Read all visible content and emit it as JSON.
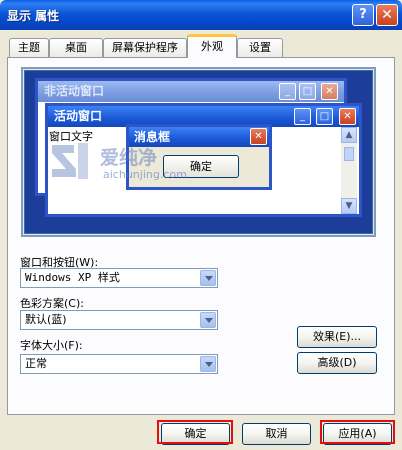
{
  "window": {
    "title": "显示 属性",
    "help_btn": "?",
    "close_btn": "✕"
  },
  "tabs": [
    "主题",
    "桌面",
    "屏幕保护程序",
    "外观",
    "设置"
  ],
  "preview": {
    "inactive_title": "非活动窗口",
    "active_title": "活动窗口",
    "window_text": "窗口文字",
    "msgbox_title": "消息框",
    "msgbox_ok": "确定"
  },
  "watermark": {
    "name": "爱纯净",
    "url": "aichunjing.com"
  },
  "form": {
    "windows_buttons_label": "窗口和按钮(W):",
    "windows_buttons_value": "Windows XP 样式",
    "color_scheme_label": "色彩方案(C):",
    "color_scheme_value": "默认(蓝)",
    "font_size_label": "字体大小(F):",
    "font_size_value": "正常",
    "effects_button": "效果(E)...",
    "advanced_button": "高级(D)"
  },
  "footer": {
    "ok": "确定",
    "cancel": "取消",
    "apply": "应用(A)"
  },
  "colors": {
    "titlebar": "#0A5FE6",
    "highlight": "#E01010",
    "dialog_bg": "#ECE9D8"
  }
}
